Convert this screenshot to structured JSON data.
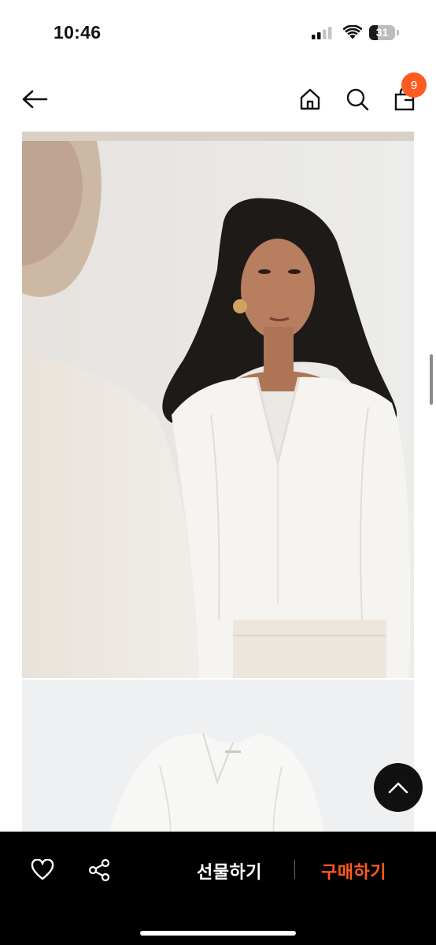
{
  "status_bar": {
    "time": "10:46",
    "battery": "31",
    "icons": [
      "cellular-signal-icon",
      "wifi-icon",
      "battery-icon"
    ]
  },
  "header": {
    "icons": [
      "back-arrow-icon",
      "home-icon",
      "search-icon",
      "shopping-bag-icon"
    ],
    "cart_count": "9"
  },
  "product": {
    "images": [
      "model-wearing-white-blouse-photo",
      "white-blouse-flat-photo"
    ]
  },
  "floating": {
    "scroll_top_icon": "chevron-up-icon"
  },
  "bottom_bar": {
    "icons": [
      "heart-icon",
      "share-icon"
    ],
    "gift_label": "선물하기",
    "buy_label": "구매하기"
  },
  "colors": {
    "accent": "#ff5a1f",
    "bar_background": "#000000",
    "badge": "#ff5a1f"
  }
}
